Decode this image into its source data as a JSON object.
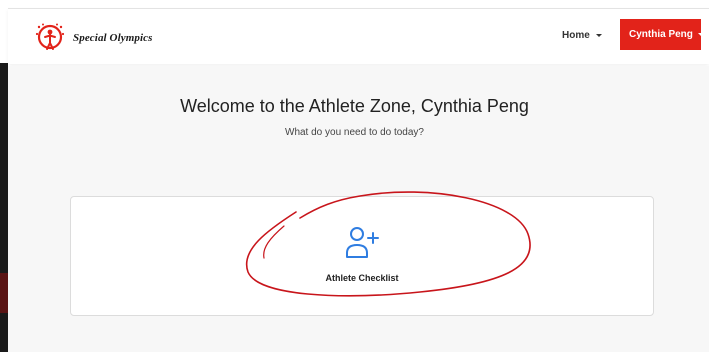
{
  "header": {
    "brand_text": "Special Olympics",
    "logo_icon": "special-olympics-logo",
    "home_label": "Home",
    "user_label": "Cynthia Peng",
    "accent_color": "#e2231a"
  },
  "main": {
    "welcome_title": "Welcome to the Athlete Zone, Cynthia Peng",
    "subtitle": "What do you need to do today?",
    "cards": [
      {
        "label": "Athlete Checklist",
        "icon": "add-user-icon",
        "icon_color": "#2f7de1"
      }
    ]
  },
  "annotation": {
    "type": "hand-drawn-circle",
    "color": "#c8151b"
  }
}
